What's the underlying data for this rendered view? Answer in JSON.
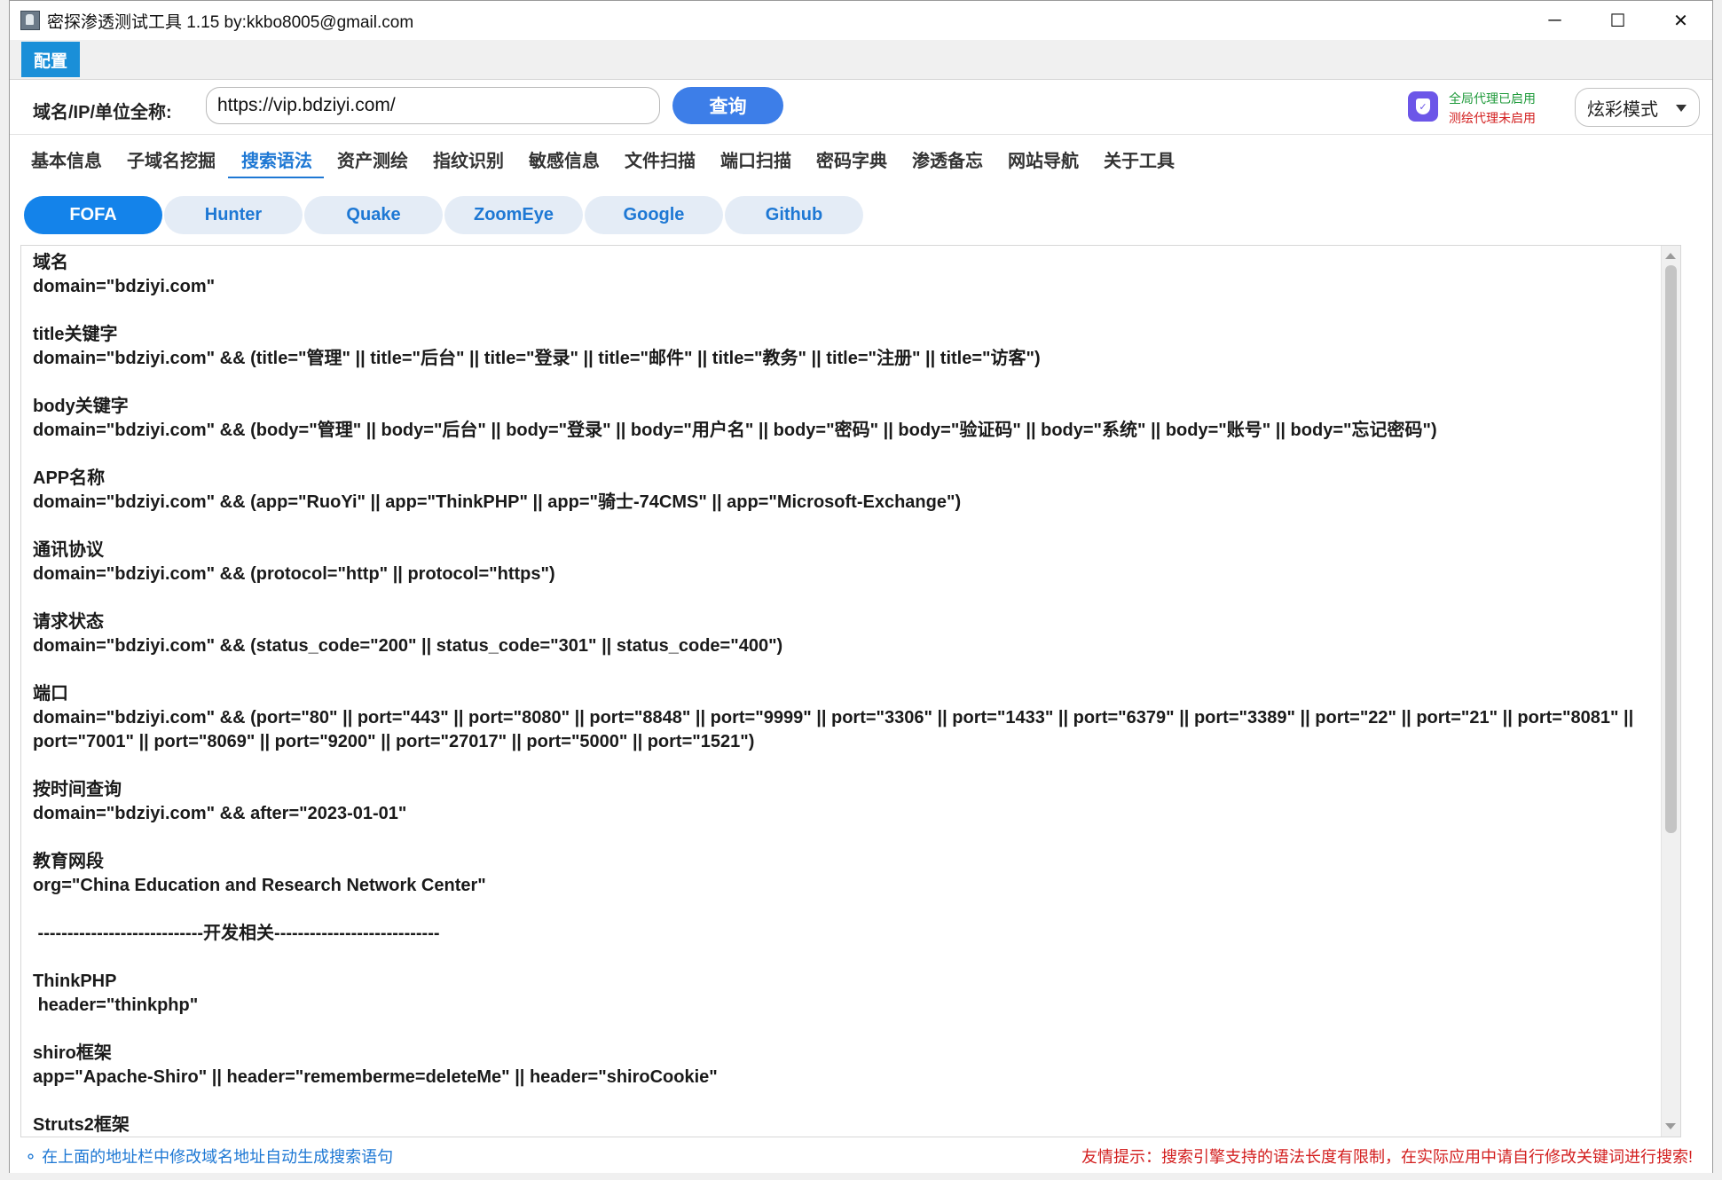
{
  "window": {
    "title": "密探渗透测试工具 1.15 by:kkbo8005@gmail.com",
    "controls": {
      "minimize": "─",
      "maximize": "☐",
      "close": "✕"
    }
  },
  "menu": {
    "config": "配置"
  },
  "query": {
    "label": "域名/IP/单位全称:",
    "value": "https://vip.bdziyi.com/",
    "button": "查询"
  },
  "proxy": {
    "global": "全局代理已启用",
    "mapping": "测绘代理未启用",
    "icon": "shield-icon"
  },
  "mode": {
    "selected": "炫彩模式"
  },
  "main_tabs": [
    "基本信息",
    "子域名挖掘",
    "搜索语法",
    "资产测绘",
    "指纹识别",
    "敏感信息",
    "文件扫描",
    "端口扫描",
    "密码字典",
    "渗透备忘",
    "网站导航",
    "关于工具"
  ],
  "active_main_tab": "搜索语法",
  "engines": [
    "FOFA",
    "Hunter",
    "Quake",
    "ZoomEye",
    "Google",
    "Github"
  ],
  "active_engine": "FOFA",
  "blocks": [
    {
      "title": "域名",
      "query": "domain=\"bdziyi.com\""
    },
    {
      "title": "title关键字",
      "query": "domain=\"bdziyi.com\" && (title=\"管理\" || title=\"后台\" || title=\"登录\" || title=\"邮件\" || title=\"教务\" || title=\"注册\" || title=\"访客\")"
    },
    {
      "title": "body关键字",
      "query": "domain=\"bdziyi.com\" && (body=\"管理\" || body=\"后台\" || body=\"登录\" || body=\"用户名\" || body=\"密码\" || body=\"验证码\" || body=\"系统\" || body=\"账号\" || body=\"忘记密码\")"
    },
    {
      "title": "APP名称",
      "query": "domain=\"bdziyi.com\" && (app=\"RuoYi\" || app=\"ThinkPHP\" || app=\"骑士-74CMS\" || app=\"Microsoft-Exchange\")"
    },
    {
      "title": "通讯协议",
      "query": "domain=\"bdziyi.com\" && (protocol=\"http\" || protocol=\"https\")"
    },
    {
      "title": "请求状态",
      "query": "domain=\"bdziyi.com\" && (status_code=\"200\" || status_code=\"301\" || status_code=\"400\")"
    },
    {
      "title": "端口",
      "query": "domain=\"bdziyi.com\" && (port=\"80\" || port=\"443\" || port=\"8080\" || port=\"8848\" || port=\"9999\" || port=\"3306\" || port=\"1433\" || port=\"6379\" || port=\"3389\" || port=\"22\" || port=\"21\" || port=\"8081\" || port=\"7001\" || port=\"8069\" || port=\"9200\" || port=\"27017\" || port=\"5000\" || port=\"1521\")"
    },
    {
      "title": "按时间查询",
      "query": "domain=\"bdziyi.com\" && after=\"2023-01-01\""
    },
    {
      "title": "教育网段",
      "query": "org=\"China Education and Research Network Center\""
    }
  ],
  "divider": " ----------------------------开发相关----------------------------",
  "dev_blocks": [
    {
      "title": "ThinkPHP",
      "query": " header=\"thinkphp\""
    },
    {
      "title": "shiro框架",
      "query": "app=\"Apache-Shiro\" || header=\"rememberme=deleteMe\" || header=\"shiroCookie\""
    },
    {
      "title": "Struts2框架",
      "query": ""
    }
  ],
  "status": {
    "left": "⚬ 在上面的地址栏中修改域名地址自动生成搜索语句",
    "right": "友情提示：搜索引擎支持的语法长度有限制，在实际应用中请自行修改关键词进行搜索!"
  }
}
